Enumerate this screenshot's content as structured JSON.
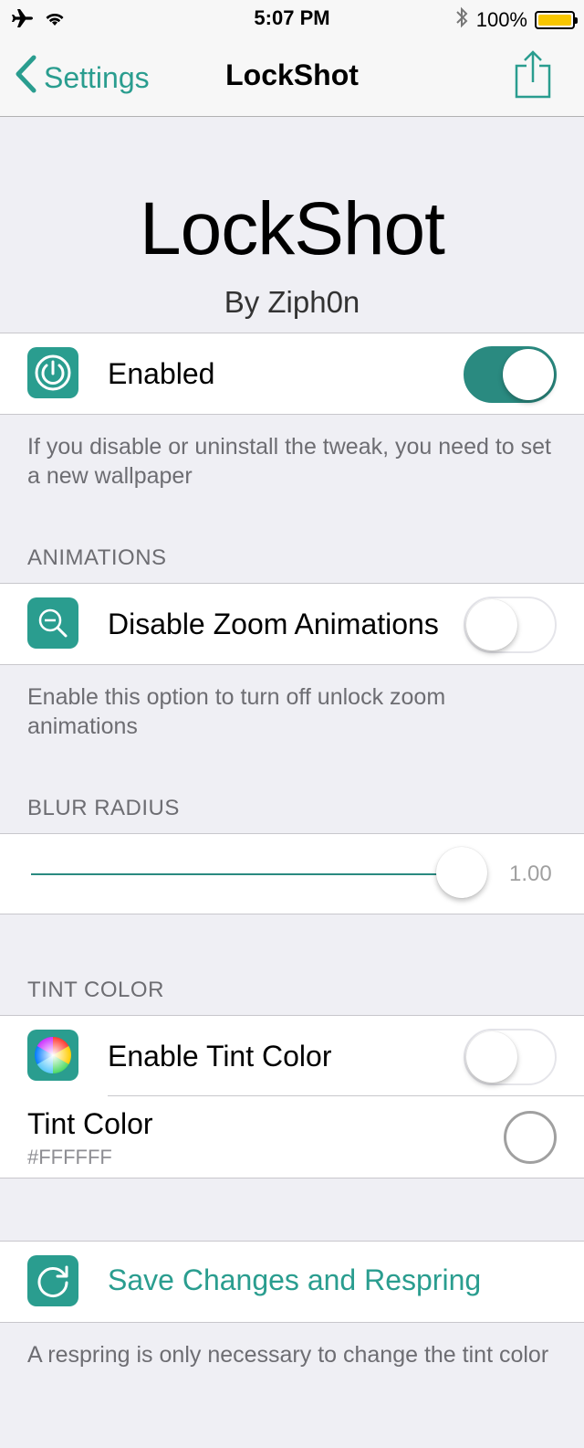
{
  "status_bar": {
    "time": "5:07 PM",
    "battery": "100%"
  },
  "nav": {
    "back_label": "Settings",
    "title": "LockShot"
  },
  "header": {
    "title": "LockShot",
    "author": "By Ziph0n"
  },
  "enabled": {
    "label": "Enabled",
    "on": true,
    "footnote": "If you disable or uninstall the tweak, you need to set a new wallpaper"
  },
  "animations": {
    "section_title": "ANIMATIONS",
    "disable_zoom_label": "Disable Zoom Animations",
    "disable_zoom_on": false,
    "footnote": "Enable this option to turn off unlock zoom animations"
  },
  "blur": {
    "section_title": "BLUR RADIUS",
    "value_text": "1.00",
    "value": 1.0
  },
  "tint": {
    "section_title": "TINT COLOR",
    "enable_label": "Enable Tint Color",
    "enable_on": false,
    "color_label": "Tint Color",
    "color_value": "#FFFFFF"
  },
  "save": {
    "label": "Save Changes and Respring",
    "footnote": "A respring is only necessary to change the tint color"
  },
  "colors": {
    "accent": "#2a9d8f",
    "toggle_on": "#2a8a80",
    "background": "#efeff4"
  }
}
